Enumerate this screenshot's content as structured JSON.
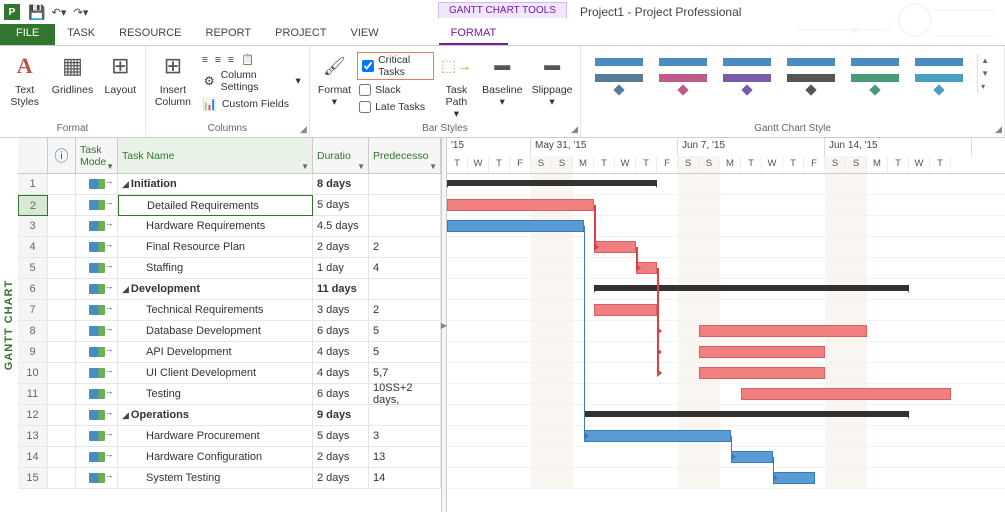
{
  "title": "Project1 - Project Professional",
  "tool_tab": "GANTT CHART TOOLS",
  "tabs": {
    "file": "FILE",
    "task": "TASK",
    "resource": "RESOURCE",
    "report": "REPORT",
    "project": "PROJECT",
    "view": "VIEW",
    "format": "FORMAT"
  },
  "ribbon": {
    "format_group": {
      "text_styles": "Text\nStyles",
      "gridlines": "Gridlines",
      "layout": "Layout",
      "label": "Format"
    },
    "columns_group": {
      "insert_column": "Insert\nColumn",
      "column_settings": "Column Settings",
      "custom_fields": "Custom Fields",
      "label": "Columns"
    },
    "format2": {
      "format": "Format"
    },
    "checks": {
      "critical": "Critical Tasks",
      "slack": "Slack",
      "late": "Late Tasks"
    },
    "barstyles": {
      "task_path": "Task\nPath",
      "baseline": "Baseline",
      "slippage": "Slippage",
      "label": "Bar Styles"
    },
    "gallery_label": "Gantt Chart Style"
  },
  "sidebar_label": "GANTT CHART",
  "columns": {
    "info_icon": "ⓘ",
    "task_mode": "Task\nMode",
    "task_name": "Task Name",
    "duration": "Duratio",
    "predecessors": "Predecesso"
  },
  "timeline": {
    "weeks": [
      "'15",
      "May 31, '15",
      "Jun 7, '15",
      "Jun 14, '15"
    ],
    "days": [
      "T",
      "W",
      "T",
      "F",
      "S",
      "S",
      "M",
      "T",
      "W",
      "T",
      "F",
      "S",
      "S",
      "M",
      "T",
      "W",
      "T",
      "F",
      "S",
      "S",
      "M",
      "T",
      "W",
      "T"
    ]
  },
  "tasks": [
    {
      "id": "1",
      "name": "Initiation",
      "dur": "8 days",
      "pred": "",
      "summary": true,
      "level": 0
    },
    {
      "id": "2",
      "name": "Detailed Requirements",
      "dur": "5 days",
      "pred": "",
      "summary": false,
      "level": 1
    },
    {
      "id": "3",
      "name": "Hardware Requirements",
      "dur": "4.5 days",
      "pred": "",
      "summary": false,
      "level": 1
    },
    {
      "id": "4",
      "name": "Final Resource Plan",
      "dur": "2 days",
      "pred": "2",
      "summary": false,
      "level": 1
    },
    {
      "id": "5",
      "name": "Staffing",
      "dur": "1 day",
      "pred": "4",
      "summary": false,
      "level": 1
    },
    {
      "id": "6",
      "name": "Development",
      "dur": "11 days",
      "pred": "",
      "summary": true,
      "level": 0
    },
    {
      "id": "7",
      "name": "Technical Requirements",
      "dur": "3 days",
      "pred": "2",
      "summary": false,
      "level": 1
    },
    {
      "id": "8",
      "name": "Database Development",
      "dur": "6 days",
      "pred": "5",
      "summary": false,
      "level": 1
    },
    {
      "id": "9",
      "name": "API Development",
      "dur": "4 days",
      "pred": "5",
      "summary": false,
      "level": 1
    },
    {
      "id": "10",
      "name": "UI Client Development",
      "dur": "4 days",
      "pred": "5,7",
      "summary": false,
      "level": 1
    },
    {
      "id": "11",
      "name": "Testing",
      "dur": "6 days",
      "pred": "10SS+2 days,",
      "summary": false,
      "level": 1
    },
    {
      "id": "12",
      "name": "Operations",
      "dur": "9 days",
      "pred": "",
      "summary": true,
      "level": 0
    },
    {
      "id": "13",
      "name": "Hardware Procurement",
      "dur": "5 days",
      "pred": "3",
      "summary": false,
      "level": 1
    },
    {
      "id": "14",
      "name": "Hardware Configuration",
      "dur": "2 days",
      "pred": "13",
      "summary": false,
      "level": 1
    },
    {
      "id": "15",
      "name": "System Testing",
      "dur": "2 days",
      "pred": "14",
      "summary": false,
      "level": 1
    }
  ],
  "chart_data": {
    "type": "gantt",
    "unit": "days",
    "day0": "2015-05-26",
    "weekend_offsets": [
      4,
      5,
      11,
      12,
      18,
      19
    ],
    "bars": [
      {
        "row": 0,
        "type": "summary",
        "start": 0,
        "len": 10
      },
      {
        "row": 1,
        "type": "critical",
        "start": 0,
        "len": 7
      },
      {
        "row": 2,
        "type": "normal",
        "start": 0,
        "len": 6.5
      },
      {
        "row": 3,
        "type": "critical",
        "start": 7,
        "len": 2
      },
      {
        "row": 4,
        "type": "critical",
        "start": 9,
        "len": 1
      },
      {
        "row": 5,
        "type": "summary",
        "start": 7,
        "len": 15
      },
      {
        "row": 6,
        "type": "critical",
        "start": 7,
        "len": 3
      },
      {
        "row": 7,
        "type": "critical",
        "start": 12,
        "len": 8
      },
      {
        "row": 8,
        "type": "critical",
        "start": 12,
        "len": 6
      },
      {
        "row": 9,
        "type": "critical",
        "start": 12,
        "len": 6
      },
      {
        "row": 10,
        "type": "critical",
        "start": 14,
        "len": 10
      },
      {
        "row": 11,
        "type": "summary",
        "start": 6.5,
        "len": 15.5
      },
      {
        "row": 12,
        "type": "normal",
        "start": 6.5,
        "len": 7
      },
      {
        "row": 13,
        "type": "normal",
        "start": 13.5,
        "len": 2
      },
      {
        "row": 14,
        "type": "normal",
        "start": 15.5,
        "len": 2
      }
    ]
  }
}
